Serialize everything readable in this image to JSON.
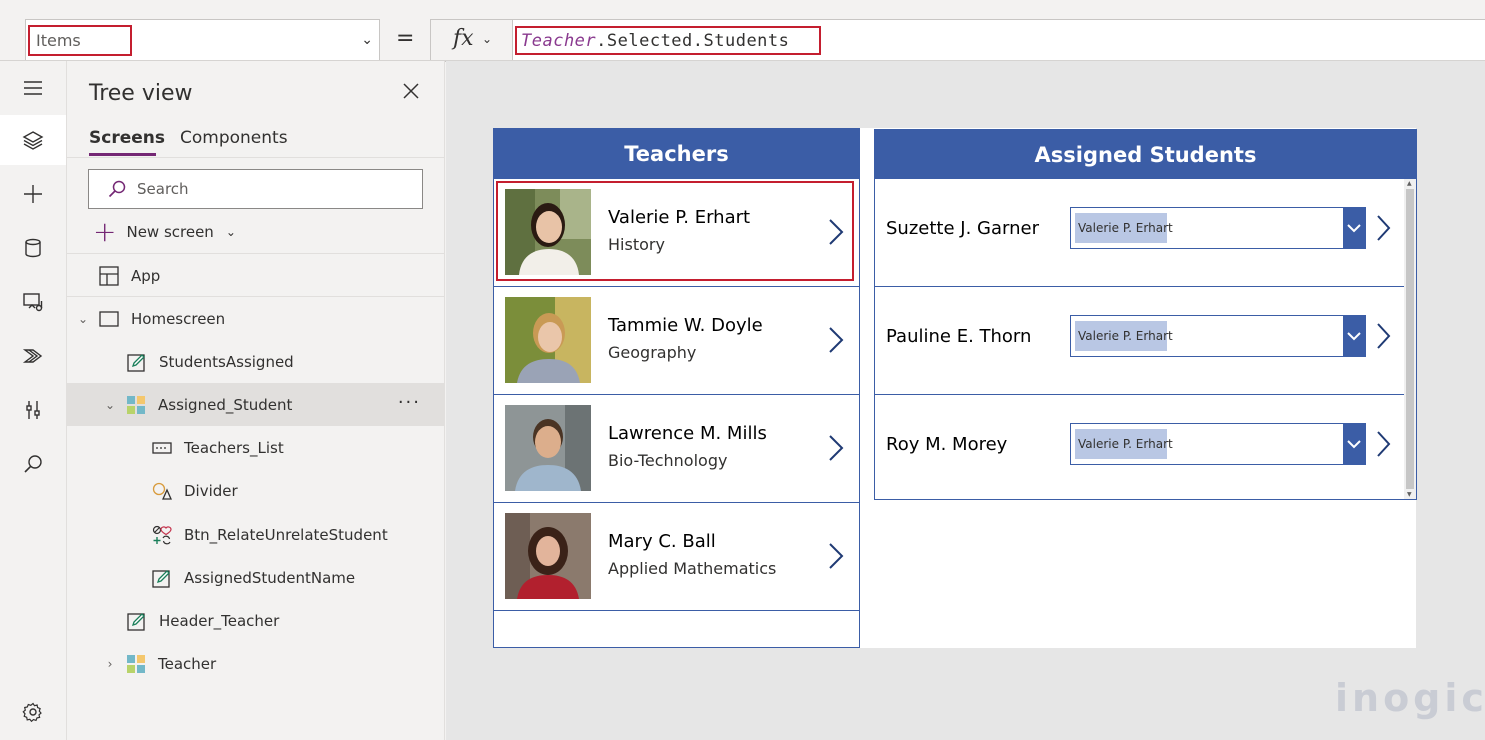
{
  "formula_bar": {
    "property": "Items",
    "equals": "=",
    "fx": "fx",
    "formula_object": "Teacher",
    "formula_rest": ".Selected.Students"
  },
  "rail": {
    "items": [
      "hamburger-icon",
      "layers-icon",
      "plus-icon",
      "database-icon",
      "media-icon",
      "power-automate-icon",
      "tools-icon",
      "search-icon",
      "settings-icon"
    ]
  },
  "tree": {
    "title": "Tree view",
    "tabs": [
      {
        "label": "Screens",
        "active": true
      },
      {
        "label": "Components",
        "active": false
      }
    ],
    "search_placeholder": "Search",
    "new_screen_label": "New screen",
    "nodes": [
      {
        "label": "App"
      },
      {
        "label": "Homescreen"
      },
      {
        "label": "StudentsAssigned"
      },
      {
        "label": "Assigned_Student"
      },
      {
        "label": "Teachers_List"
      },
      {
        "label": "Divider"
      },
      {
        "label": "Btn_RelateUnrelateStudent"
      },
      {
        "label": "AssignedStudentName"
      },
      {
        "label": "Header_Teacher"
      },
      {
        "label": "Teacher"
      }
    ],
    "more_label": "···"
  },
  "app": {
    "teachers_header": "Teachers",
    "teachers": [
      {
        "name": "Valerie P. Erhart",
        "subject": "History",
        "selected": true
      },
      {
        "name": "Tammie W. Doyle",
        "subject": "Geography",
        "selected": false
      },
      {
        "name": "Lawrence M. Mills",
        "subject": "Bio-Technology",
        "selected": false
      },
      {
        "name": "Mary C. Ball",
        "subject": "Applied Mathematics",
        "selected": false
      }
    ],
    "students_header": "Assigned Students",
    "students": [
      {
        "name": "Suzette J. Garner",
        "teacher": "Valerie P. Erhart"
      },
      {
        "name": "Pauline E. Thorn",
        "teacher": "Valerie P. Erhart"
      },
      {
        "name": "Roy M. Morey",
        "teacher": "Valerie P. Erhart"
      }
    ]
  },
  "watermark": "inogic",
  "colors": {
    "accent": "#3b5da6",
    "highlight": "#c41e2f",
    "purple": "#742774",
    "dropdown_value_bg": "#b9c7e4"
  }
}
